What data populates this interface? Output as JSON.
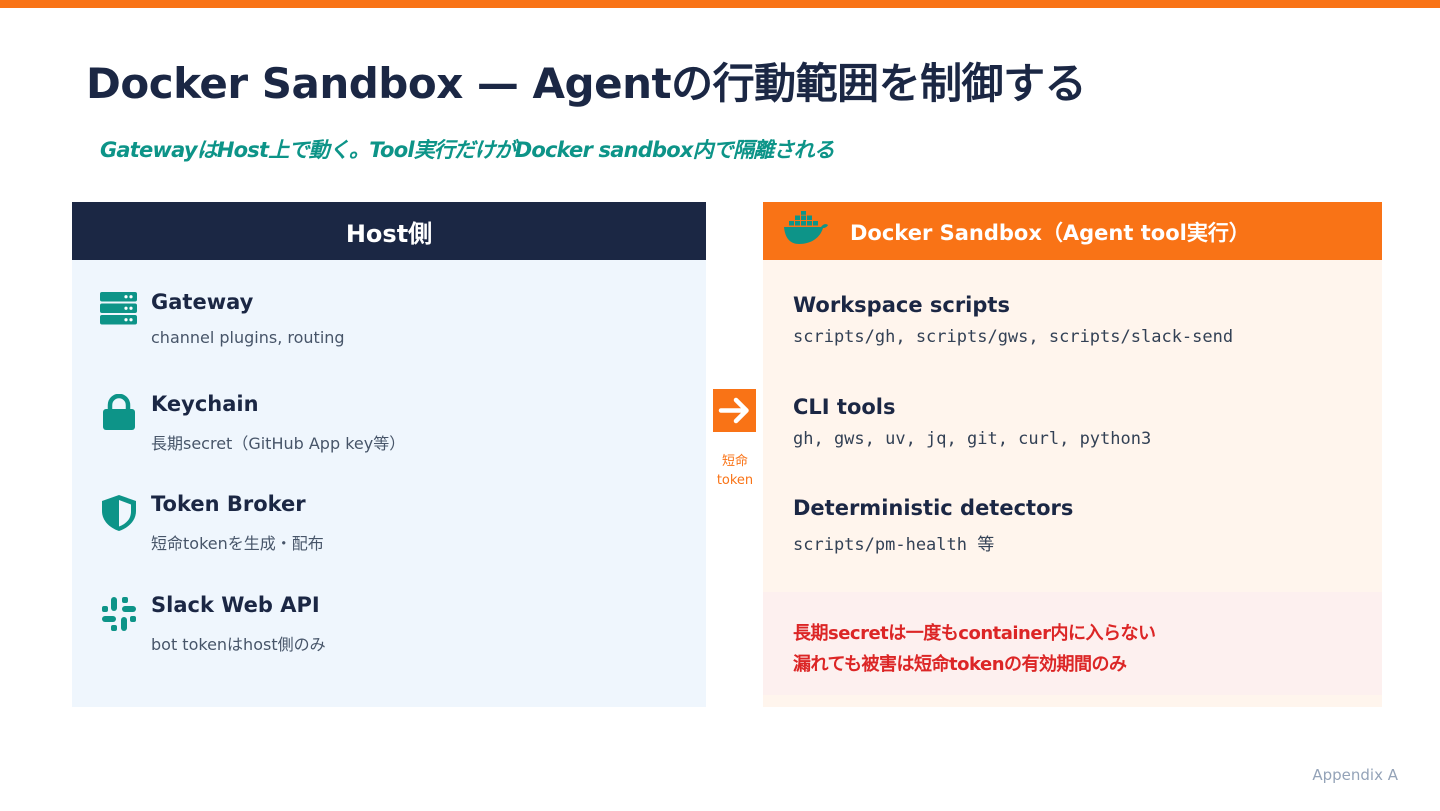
{
  "slide": {
    "title": "Docker Sandbox — Agentの行動範囲を制御する",
    "subtitle": "GatewayはHost上で動く。Tool実行だけがDocker sandbox内で隔離される",
    "footer": "Appendix A"
  },
  "host": {
    "header": "Host側",
    "items": [
      {
        "name": "Gateway",
        "desc": "channel plugins, routing",
        "icon": "server-stack-icon"
      },
      {
        "name": "Keychain",
        "desc": "長期secret（GitHub App key等）",
        "icon": "lock-icon"
      },
      {
        "name": "Token Broker",
        "desc": "短命tokenを生成・配布",
        "icon": "shield-icon"
      },
      {
        "name": "Slack Web API",
        "desc": "bot tokenはhost側のみ",
        "icon": "slack-icon"
      }
    ]
  },
  "arrow": {
    "label": "短命\ntoken",
    "icon": "arrow-right-icon"
  },
  "docker": {
    "header": "Docker Sandbox（Agent tool実行）",
    "icon": "docker-whale-icon",
    "items": [
      {
        "name": "Workspace scripts",
        "code": "scripts/gh, scripts/gws, scripts/slack-send"
      },
      {
        "name": "CLI tools",
        "code": "gh, gws, uv, jq, git, curl, python3"
      },
      {
        "name": "Deterministic detectors",
        "code": "scripts/pm-health 等"
      }
    ],
    "warning": {
      "line1": "長期secretは一度もcontainer内に入らない",
      "line2": "漏れても被害は短命tokenの有効期間のみ"
    }
  },
  "colors": {
    "accent": "#f97316",
    "navy": "#1b2744",
    "teal": "#0d9488",
    "warning": "#dc2626"
  }
}
